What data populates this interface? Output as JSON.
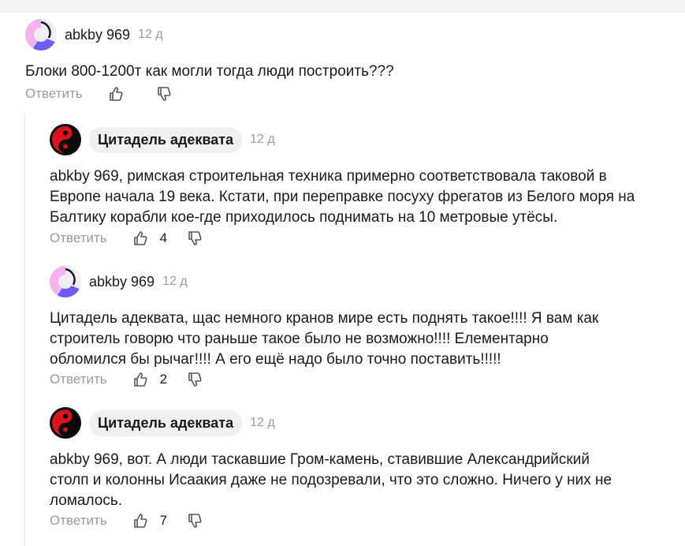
{
  "comments": [
    {
      "author": "abkby 969",
      "time": "12 д",
      "text": "Блоки 800-1200т как могли тогда люди построить???",
      "reply_label": "Ответить",
      "likes": ""
    },
    {
      "author": "Цитадель адеквата",
      "time": "12 д",
      "text": "abkby 969, римская строительная техника примерно соответствовала таковой в\nЕвропе начала 19 века. Кстати, при переправке посуху фрегатов из Белого моря на\nБалтику корабли кое-где приходилось поднимать на 10 метровые утёсы.",
      "reply_label": "Ответить",
      "likes": "4"
    },
    {
      "author": "abkby 969",
      "time": "12 д",
      "text": "Цитадель адеквата, щас немного кранов мире есть поднять такое!!!! Я вам как\nстроитель говорю что раньше такое было не возможно!!!! Елементарно\nобломился бы рычаг!!!! А его ещё надо было точно поставить!!!!!",
      "reply_label": "Ответить",
      "likes": "2"
    },
    {
      "author": "Цитадель адеквата",
      "time": "12 д",
      "text": "abkby 969, вот. А люди таскавшие Гром-камень, ставившие Александрийский\nстолп и колонны Исаакия даже не подозревали, что это сложно. Ничего у них не\nломалось.",
      "reply_label": "Ответить",
      "likes": "7"
    }
  ],
  "icons": {
    "avatar_abkby": "avatar-icon",
    "avatar_citadel": "yin-yang-icon",
    "like": "thumbs-up-icon",
    "dislike": "thumbs-down-icon"
  },
  "colors": {
    "text": "#1a1a1a",
    "muted": "#9a9aa0",
    "pill": "#f0f0f2",
    "avatar_pink": "#f4b3ee",
    "avatar_purple": "#6d5cf5",
    "yinyang_red": "#d9121b"
  }
}
